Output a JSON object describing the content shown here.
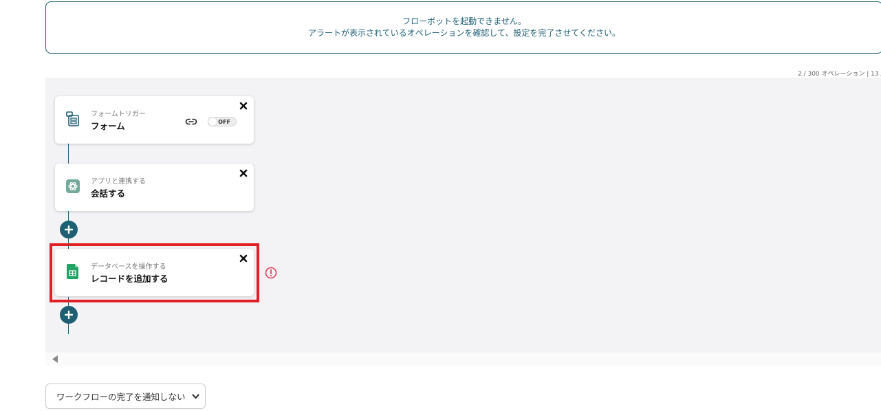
{
  "alert": {
    "line1": "フローボットを起動できません。",
    "line2": "アラートが表示されているオペレーションを確認して、設定を完了させてください。"
  },
  "operations_count": "2 / 300 オペレーション | 13 /",
  "steps": [
    {
      "subtitle": "フォームトリガー",
      "title": "フォーム",
      "icon": "form-icon",
      "toggle_label": "OFF",
      "toggle_state": "off"
    },
    {
      "subtitle": "アプリと連携する",
      "title": "会話する",
      "icon": "chatgpt-icon"
    },
    {
      "subtitle": "データベースを操作する",
      "title": "レコードを追加する",
      "icon": "google-sheets-icon",
      "alert": true
    }
  ],
  "notify_select": {
    "value": "ワークフローの完了を通知しない"
  },
  "colors": {
    "accent": "#1e5f74",
    "highlight": "#e31e24",
    "warning": "#e0405a",
    "sheets": "#1fa463",
    "chatgpt": "#74aa9c"
  }
}
